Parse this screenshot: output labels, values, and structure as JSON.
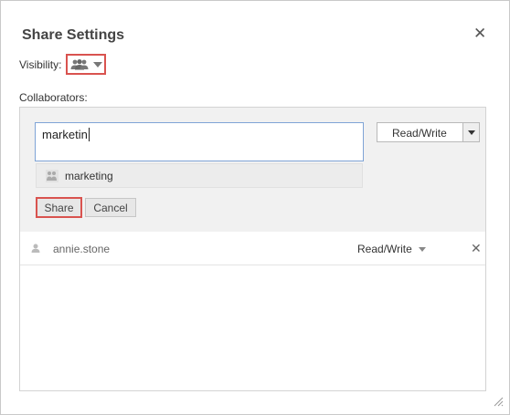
{
  "dialog": {
    "title": "Share Settings",
    "close_label": "✕"
  },
  "visibility": {
    "label": "Visibility:",
    "icon": "people-icon"
  },
  "collaborators": {
    "label": "Collaborators:",
    "input_value": "marketin",
    "permission_value": "Read/Write",
    "suggestions": [
      {
        "label": "marketing",
        "icon": "group-icon"
      }
    ],
    "share_label": "Share",
    "cancel_label": "Cancel",
    "list": [
      {
        "name": "annie.stone",
        "role": "Read/Write",
        "remove": "✕"
      }
    ]
  },
  "colors": {
    "highlight_border": "#d9534f",
    "input_focus_border": "#7fa4d6",
    "panel_bg": "#f1f1f1"
  }
}
